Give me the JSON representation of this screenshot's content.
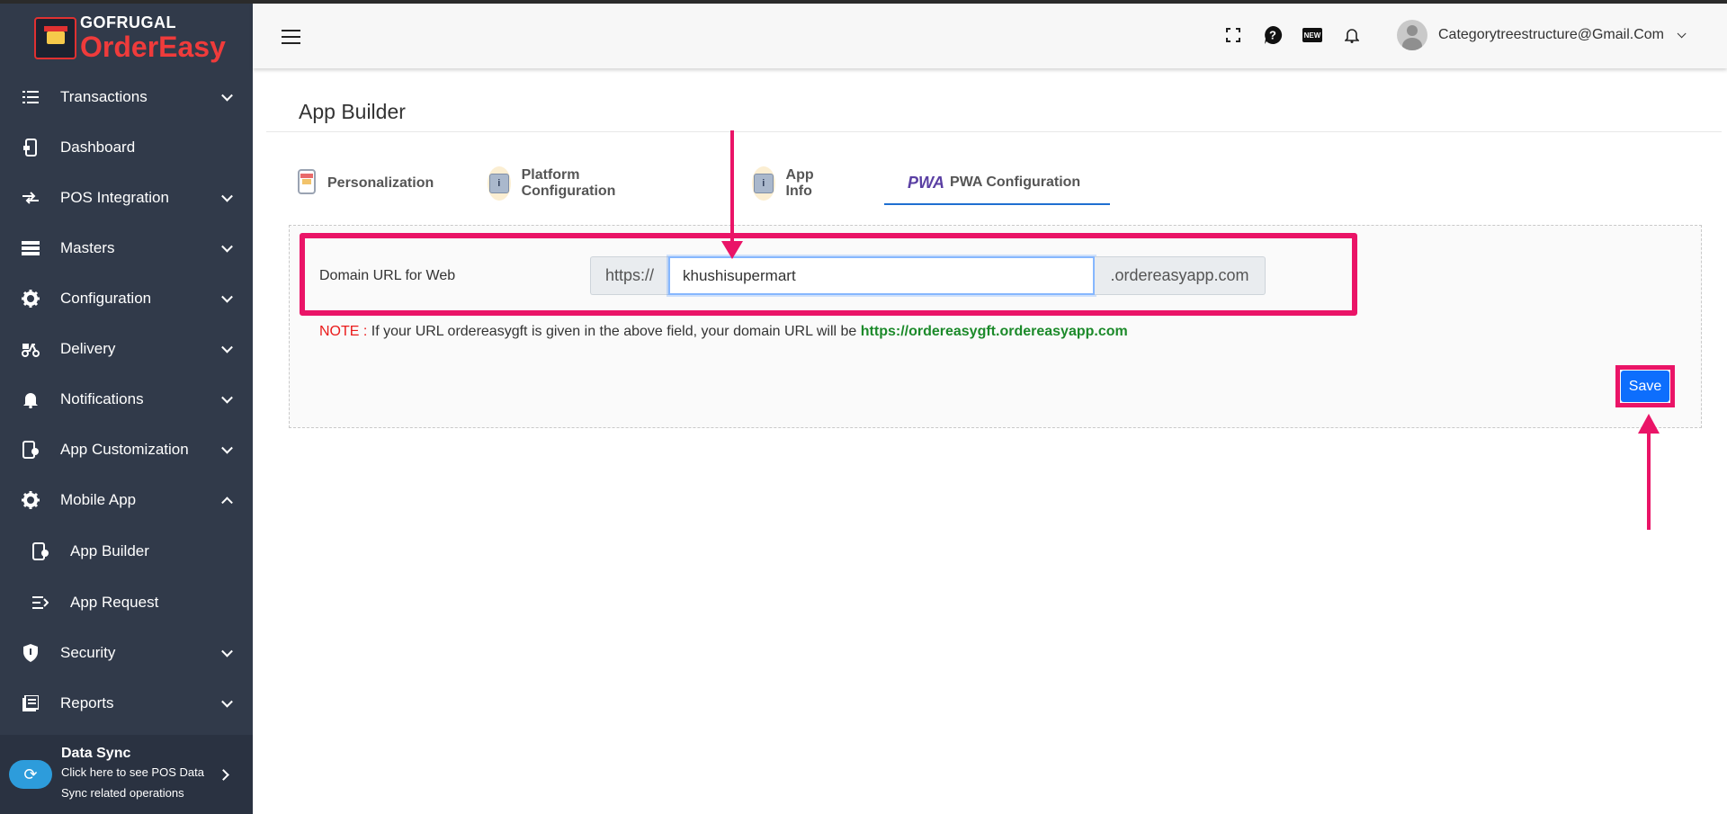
{
  "brand": {
    "top": "GOFRUGAL",
    "bottom": "OrderEasy"
  },
  "sidebar": {
    "items": [
      {
        "label": "Transactions",
        "icon": "list-icon",
        "chevron": "down"
      },
      {
        "label": "Dashboard",
        "icon": "dashboard-icon",
        "chevron": ""
      },
      {
        "label": "POS Integration",
        "icon": "swap-icon",
        "chevron": "down"
      },
      {
        "label": "Masters",
        "icon": "stack-icon",
        "chevron": "down"
      },
      {
        "label": "Configuration",
        "icon": "gear-icon",
        "chevron": "down"
      },
      {
        "label": "Delivery",
        "icon": "scooter-icon",
        "chevron": "down"
      },
      {
        "label": "Notifications",
        "icon": "bell-icon",
        "chevron": "down"
      },
      {
        "label": "App Customization",
        "icon": "app-edit-icon",
        "chevron": "down"
      },
      {
        "label": "Mobile App",
        "icon": "gear-icon",
        "chevron": "up"
      }
    ],
    "sub_items": [
      {
        "label": "App Builder",
        "icon": "app-edit-icon"
      },
      {
        "label": "App Request",
        "icon": "request-list-icon"
      }
    ],
    "items_after": [
      {
        "label": "Security",
        "icon": "shield-icon",
        "chevron": "down"
      },
      {
        "label": "Reports",
        "icon": "report-icon",
        "chevron": "down"
      }
    ],
    "data_sync": {
      "title": "Data Sync",
      "subtitle": "Click here to see POS Data Sync related operations"
    }
  },
  "header": {
    "icons": [
      "fullscreen-icon",
      "help-icon",
      "new-badge-icon",
      "bell-icon"
    ],
    "new_badge": "NEW",
    "user_email": "Categorytreestructure@Gmail.Com"
  },
  "page": {
    "title": "App Builder",
    "tabs": [
      {
        "label": "Personalization",
        "active": false
      },
      {
        "label": "Platform Configuration",
        "active": false
      },
      {
        "label": "App Info",
        "active": false
      },
      {
        "label": "PWA Configuration",
        "active": true
      }
    ],
    "pwa_logo": "PWA",
    "form": {
      "label": "Domain URL for Web",
      "prefix": "https://",
      "value": "khushisupermart",
      "suffix": ".ordereasyapp.com"
    },
    "note": {
      "label": "NOTE :",
      "text": " If your URL ordereasygft is given in the above field, your domain URL will be ",
      "url": "https://ordereasygft.ordereasyapp.com"
    },
    "save_label": "Save"
  },
  "colors": {
    "sidebar_bg": "#313a4a",
    "highlight": "#ea1467",
    "primary": "#0d6efd",
    "note_red": "#ea1a1a",
    "note_green": "#1c8a2a"
  }
}
